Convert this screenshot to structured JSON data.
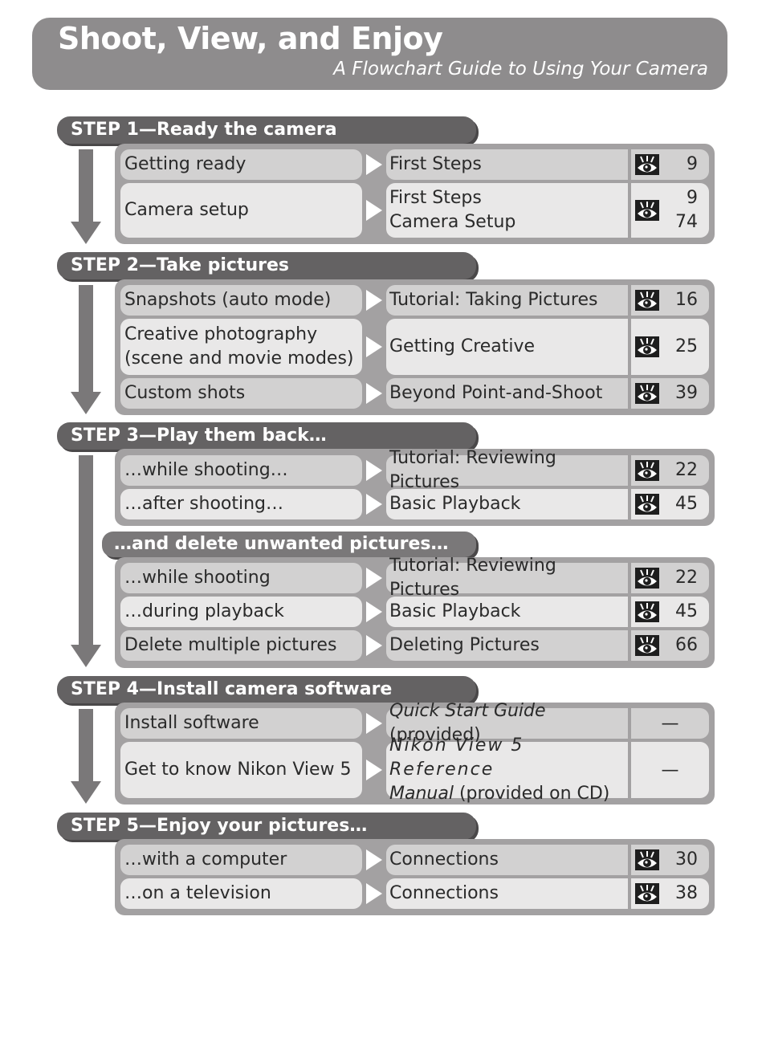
{
  "header": {
    "title": "Shoot, View, and Enjoy",
    "subtitle": "A Flowchart Guide to Using Your Camera"
  },
  "icons": {
    "page_ref": "eye-reference-icon",
    "flow": "down-arrow-icon",
    "separator": "right-triangle-icon"
  },
  "colors": {
    "banner": "#8e8c8d",
    "step_header": "#646263",
    "panel": "#a3a1a2",
    "row_light": "#e9e8e8",
    "row_dark": "#d2d1d1",
    "icon_bg": "#1e1e1e"
  },
  "steps": [
    {
      "title": "STEP 1—Ready the camera",
      "rows": [
        {
          "task": "Getting ready",
          "ref_lines": [
            "First Steps"
          ],
          "pages": [
            "9"
          ]
        },
        {
          "task": "Camera setup",
          "ref_lines": [
            "First Steps",
            "Camera Setup"
          ],
          "pages": [
            "9",
            "74"
          ]
        }
      ]
    },
    {
      "title": "STEP 2—Take pictures",
      "rows": [
        {
          "task": "Snapshots (auto mode)",
          "ref_lines": [
            "Tutorial: Taking Pictures"
          ],
          "pages": [
            "16"
          ]
        },
        {
          "task_lines": [
            "Creative photography",
            "(scene and movie modes)"
          ],
          "ref_lines": [
            "Getting Creative"
          ],
          "pages": [
            "25"
          ]
        },
        {
          "task": "Custom shots",
          "ref_lines": [
            "Beyond Point-and-Shoot"
          ],
          "pages": [
            "39"
          ]
        }
      ]
    },
    {
      "title": "STEP 3—Play them back…",
      "rows": [
        {
          "task": "…while shooting…",
          "ref_lines": [
            "Tutorial: Reviewing Pictures"
          ],
          "pages": [
            "22"
          ]
        },
        {
          "task": "…after shooting…",
          "ref_lines": [
            "Basic Playback"
          ],
          "pages": [
            "45"
          ]
        }
      ],
      "sub": {
        "title": "…and delete unwanted pictures…",
        "rows": [
          {
            "task": "…while shooting",
            "ref_lines": [
              "Tutorial: Reviewing Pictures"
            ],
            "pages": [
              "22"
            ]
          },
          {
            "task": "…during playback",
            "ref_lines": [
              "Basic Playback"
            ],
            "pages": [
              "45"
            ]
          },
          {
            "task": "Delete multiple pictures",
            "ref_lines": [
              "Deleting Pictures"
            ],
            "pages": [
              "66"
            ]
          }
        ]
      }
    },
    {
      "title": "STEP 4—Install camera software",
      "rows": [
        {
          "task": "Install software",
          "ref_italic": "Quick Start Guide",
          "ref_rest": " (provided)",
          "pages_text": "—"
        },
        {
          "task": "Get to know Nikon View 5",
          "ref_line1_italic": "Nikon View 5 Reference",
          "ref_line2_italic": "Manual",
          "ref_line2_rest": " (provided on CD)",
          "pages_text": "—"
        }
      ]
    },
    {
      "title": "STEP 5—Enjoy your pictures…",
      "rows": [
        {
          "task": "…with a computer",
          "ref_lines": [
            "Connections"
          ],
          "pages": [
            "30"
          ]
        },
        {
          "task": "…on a television",
          "ref_lines": [
            "Connections"
          ],
          "pages": [
            "38"
          ]
        }
      ]
    }
  ]
}
